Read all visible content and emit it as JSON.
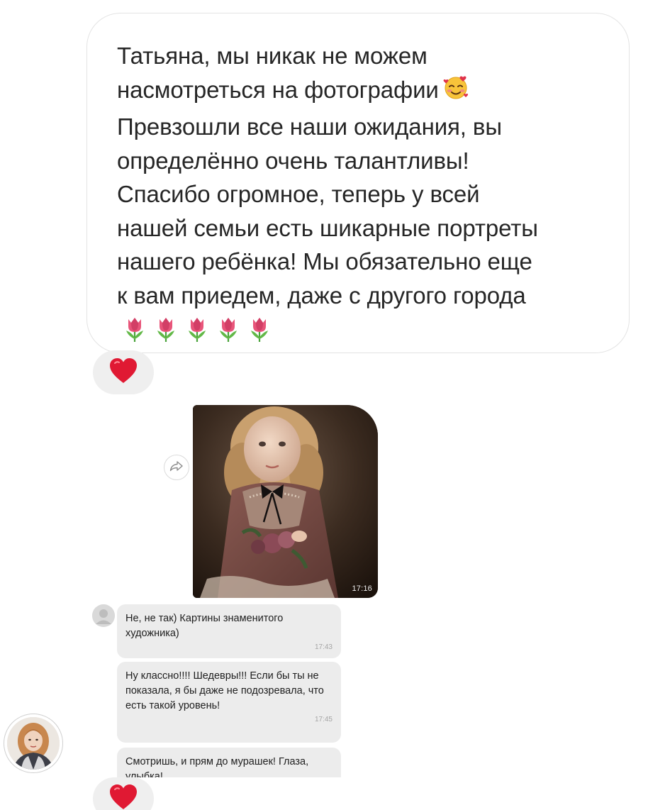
{
  "message": {
    "lines": [
      "Татьяна, мы никак не можем",
      "насмотреться на фотографии",
      "Превзошли все наши ожидания, вы",
      "определённо очень талантливы!",
      "Спасибо огромное,  теперь у всей",
      "нашей семьи есть шикарные портреты",
      "нашего ребёнка! Мы обязательно еще",
      "к вам приедем,  даже с другого города"
    ],
    "inline_emoji": "smiling-face-with-hearts-icon",
    "trailing_emoji": "tulip-icon",
    "trailing_emoji_count": 5
  },
  "reactions": {
    "first": "heart-icon",
    "second": "heart-icon"
  },
  "shared_photo": {
    "time": "17:16"
  },
  "embedded_chat": {
    "messages": [
      {
        "text": "Не, не так) Картины знаменитого художника)",
        "time": "17:43"
      },
      {
        "text": "Ну классно!!!! Шедевры!!! Если бы ты не показала, я бы даже не подозревала, что есть такой уровень!",
        "time": "17:45"
      },
      {
        "text": "Смотришь, и прям до мурашек! Глаза, улыбка!",
        "time": ""
      }
    ]
  },
  "colors": {
    "bubble_border": "#e3e3e3",
    "reaction_bg": "#efefef",
    "heart": "#e01933",
    "text": "#262626",
    "mini_bubble_bg": "#ececec"
  }
}
